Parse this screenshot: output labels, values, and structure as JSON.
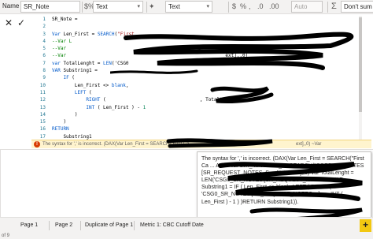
{
  "toolbar": {
    "name_label": "Name",
    "name_value": "SR_Note",
    "format_icon": "dollar-percent-icon",
    "format_value": "Text",
    "data_type_icon": "paint-format-icon",
    "data_type_value": "Text",
    "comma_icon": "comma-style-icon",
    "decimals_value": "Auto",
    "summarize_icon": "sigma-icon",
    "summarize_value": "Don't sum"
  },
  "formula": {
    "cancel_icon": "close-icon",
    "commit_icon": "check-icon",
    "line_numbers": [
      "1",
      "2",
      "3",
      "4",
      "5",
      "6",
      "7",
      "8",
      "9",
      "10",
      "11",
      "12",
      "13",
      "14",
      "15",
      "16",
      "17"
    ],
    "error_message": "The syntax for ',' is incorrect. (DAX(Var Len_First = SEARCH(\"First Ca",
    "error_message_end": "ext],,0) ~Var"
  },
  "tooltip": {
    "text": "The syntax for ',' is incorrect. (DAX(Var Len_First = SEARCH(\"First Ca ... Ad ... Var Len_ ... Var Len_ ... SEARCH(\"CSG0_SR_NOTES [SR_REQUEST_NOTES_S ... Note Text],,0) Var TotalLenght = LEN('CSG0_SR_NOTES'[SR_REQUEST_NOTES ... VAR Substring1 = IF ( Len_First <> blank, LEFT ( RIGHT ( 'CSG0_SR_NOTES'[SR_REQUEST_NOTES ...], ..., INT ( Len_First ) - 1 ) )RETURN Substring1))."
  },
  "tabs": [
    {
      "label": "Page 1"
    },
    {
      "label": "Page 2"
    },
    {
      "label": "Duplicate of Page 1"
    },
    {
      "label": "Metric 1: CBC Cutoff Date"
    }
  ],
  "add_page_label": "+",
  "status_text": "of 9"
}
